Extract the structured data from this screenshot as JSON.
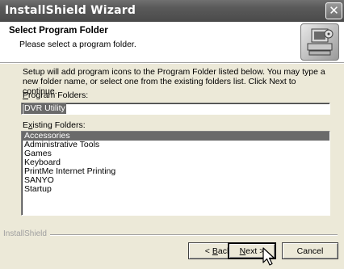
{
  "window": {
    "title": "InstallShield Wizard",
    "close_glyph": "✕"
  },
  "header": {
    "title": "Select Program Folder",
    "subtitle": "Please select a program folder.",
    "icon": "installer-computer-icon"
  },
  "body": {
    "description": "Setup will add program icons to the Program Folder listed below.  You may type a new folder name, or select one from the existing folders list.  Click Next to continue.",
    "program_folders_label_mnemonic": "P",
    "program_folders_label_rest": "rogram Folders:",
    "program_folder_value": "DVR Utility",
    "existing_folders_label_first": "E",
    "existing_folders_label_mnemonic": "x",
    "existing_folders_label_rest": "isting Folders:",
    "existing_folders": [
      "Accessories",
      "Administrative Tools",
      "Games",
      "Keyboard",
      "PrintMe Internet Printing",
      "SANYO",
      "Startup"
    ],
    "selected_folder_index": 0
  },
  "footer": {
    "brand": "InstallShield",
    "back_label_prefix": "< ",
    "back_label_mnemonic": "B",
    "back_label_rest": "ack",
    "next_label_mnemonic": "N",
    "next_label_rest": "ext >",
    "cancel_label": "Cancel"
  },
  "colors": {
    "selection": "#6a6a6a",
    "titlebar": "#5a5a5a",
    "dialog_face": "#ece9d8"
  }
}
